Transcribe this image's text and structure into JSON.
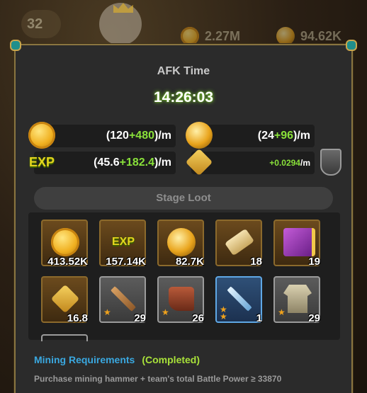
{
  "topbar": {
    "level": "32",
    "gold_amount": "2.27M",
    "orb_amount": "94.62K"
  },
  "panel": {
    "title": "AFK Time",
    "timer": "14:26:03",
    "rates": {
      "gold": {
        "base": "(120",
        "bonus": "+480",
        "suffix": ")/m"
      },
      "orb": {
        "base": "(24",
        "bonus": "+96",
        "suffix": ")/m"
      },
      "exp": {
        "icon_label": "EXP",
        "base": "(45.6",
        "bonus": "+182.4",
        "suffix": ")/m"
      },
      "gem": {
        "bonus": "+0.0294",
        "suffix": "/m"
      }
    },
    "stage_loot_label": "Stage Loot",
    "loot": [
      {
        "icon": "gold-coin-icon",
        "quantity": "413.52K",
        "frame": "gold"
      },
      {
        "icon": "exp-icon",
        "label": "EXP",
        "quantity": "157.14K",
        "frame": "gold"
      },
      {
        "icon": "golden-orb-icon",
        "quantity": "82.7K",
        "frame": "gold"
      },
      {
        "icon": "scroll-icon",
        "quantity": "18",
        "frame": "gold"
      },
      {
        "icon": "spellbook-icon",
        "quantity": "19",
        "frame": "gold"
      },
      {
        "icon": "s-gem-icon",
        "quantity": "16.8",
        "frame": "gold"
      },
      {
        "icon": "wooden-sword-icon",
        "quantity": "29",
        "frame": "grey",
        "stars": "★"
      },
      {
        "icon": "leather-boot-icon",
        "quantity": "26",
        "frame": "grey",
        "stars": "★"
      },
      {
        "icon": "steel-sword-icon",
        "quantity": "1",
        "frame": "blue",
        "stars": "★★"
      },
      {
        "icon": "tunic-armor-icon",
        "quantity": "29",
        "frame": "grey",
        "stars": "★"
      }
    ],
    "mining": {
      "label": "Mining Requirements",
      "status": "(Completed)",
      "description": "Purchase mining hammer + team's total Battle Power ≥ 33870"
    }
  },
  "colors": {
    "accent_green": "#89e13a",
    "accent_blue": "#3aa8e0",
    "panel_bg": "#2b2b2b",
    "frame_gold": "#8c6a2c"
  }
}
